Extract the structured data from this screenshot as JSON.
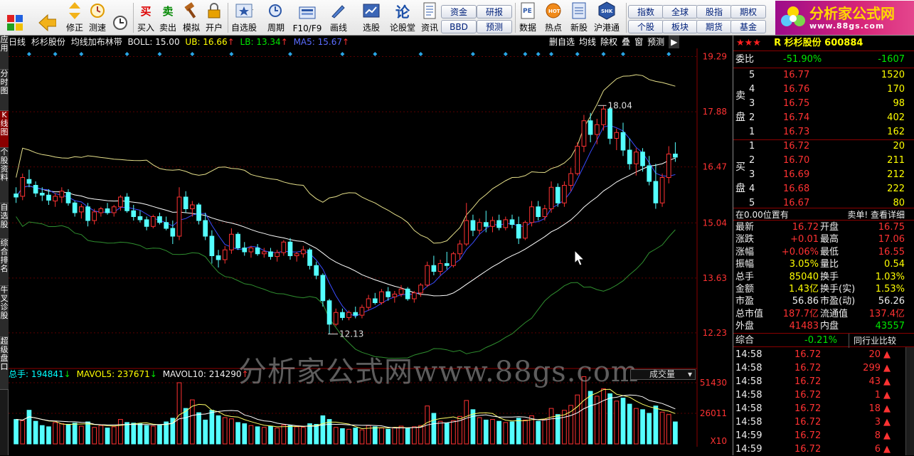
{
  "toolbar": {
    "buttons": [
      {
        "label": "",
        "icon": "grid-icon"
      },
      {
        "label": "",
        "icon": "back-arrow-icon"
      },
      {
        "label": "修正",
        "icon": "updown-icon"
      },
      {
        "label": "测速",
        "icon": "clock-icon"
      },
      {
        "label": "买入",
        "icon": "buy-icon"
      },
      {
        "label": "卖出",
        "icon": "sell-icon"
      },
      {
        "label": "模拟",
        "icon": "hammer-icon"
      },
      {
        "label": "开户",
        "icon": "lock-icon"
      },
      {
        "label": "自选股",
        "icon": "star-screen-icon"
      },
      {
        "label": "周期",
        "icon": "cycle-icon"
      },
      {
        "label": "F10/F9",
        "icon": "f10-icon"
      },
      {
        "label": "画线",
        "icon": "pen-icon"
      },
      {
        "label": "选股",
        "icon": "select-stock-icon"
      },
      {
        "label": "论股堂",
        "icon": "forum-icon"
      },
      {
        "label": "资讯",
        "icon": "news-icon"
      },
      {
        "label": "数据",
        "icon": "pe-icon"
      },
      {
        "label": "热点",
        "icon": "hot-icon"
      },
      {
        "label": "新股",
        "icon": "new-stock-icon"
      },
      {
        "label": "沪港通",
        "icon": "shhk-icon"
      }
    ],
    "pills": [
      "资金",
      "研报",
      "BBD",
      "预测",
      "指数",
      "全球",
      "股指",
      "期权",
      "个股",
      "板块",
      "期货",
      "基金"
    ],
    "logo": {
      "title": "分析家公式网",
      "url": "www.88gs.com"
    }
  },
  "lefttabs": [
    "应用",
    "分时图",
    "K线图",
    "个股资料",
    "自选股",
    "综合排名",
    "牛叉诊股",
    "超级盘口"
  ],
  "info": {
    "period": "日线",
    "stock": "杉杉股份",
    "indicator": "均线加布林带",
    "boll": "BOLL: 15.00",
    "ub": "UB: 16.66",
    "lb": "LB: 13.34",
    "ma": "MA5: 15.67",
    "tools": [
      "删自选",
      "均线",
      "除权",
      "叠",
      "窗",
      "预测"
    ]
  },
  "chart_data": {
    "type": "candlestick",
    "y_ticks": [
      19.29,
      17.88,
      16.47,
      15.04,
      13.63,
      12.23
    ],
    "ylim": [
      11.5,
      19.5
    ],
    "high_label": "18.04",
    "low_label": "12.13",
    "vol_ticks": [
      "51430",
      "26011",
      "X10"
    ],
    "volume_header": {
      "total": "总手: 194841",
      "mavol5": "MAVOL5: 237671",
      "mavol10": "MAVOL10: 214290"
    },
    "vol_selector": "成交量",
    "ohlc": [
      [
        15.78,
        15.95,
        15.55,
        15.7
      ],
      [
        15.72,
        16.3,
        15.62,
        16.2
      ],
      [
        16.15,
        16.4,
        15.95,
        16.05
      ],
      [
        16.0,
        16.1,
        15.7,
        15.8
      ],
      [
        15.8,
        15.95,
        15.6,
        15.75
      ],
      [
        15.75,
        15.9,
        15.5,
        15.62
      ],
      [
        15.6,
        15.8,
        15.45,
        15.72
      ],
      [
        15.7,
        15.95,
        15.55,
        15.85
      ],
      [
        15.82,
        15.9,
        15.48,
        15.55
      ],
      [
        15.55,
        15.6,
        15.2,
        15.3
      ],
      [
        15.32,
        15.52,
        15.15,
        15.45
      ],
      [
        15.45,
        15.55,
        14.95,
        15.1
      ],
      [
        15.1,
        15.4,
        15.0,
        15.32
      ],
      [
        15.3,
        15.45,
        15.2,
        15.4
      ],
      [
        15.4,
        15.55,
        15.25,
        15.3
      ],
      [
        15.3,
        15.5,
        15.2,
        15.45
      ],
      [
        15.45,
        15.75,
        15.35,
        15.7
      ],
      [
        15.7,
        15.8,
        15.3,
        15.35
      ],
      [
        15.35,
        15.5,
        15.1,
        15.2
      ],
      [
        15.2,
        15.35,
        15.05,
        15.12
      ],
      [
        15.12,
        15.2,
        14.85,
        14.95
      ],
      [
        14.95,
        15.25,
        14.9,
        15.2
      ],
      [
        15.2,
        15.3,
        15.0,
        15.05
      ],
      [
        15.05,
        15.2,
        14.85,
        14.9
      ],
      [
        14.9,
        15.1,
        14.5,
        14.7
      ],
      [
        14.7,
        15.95,
        14.6,
        15.7
      ],
      [
        15.7,
        15.85,
        15.3,
        15.4
      ],
      [
        15.4,
        15.6,
        15.2,
        15.5
      ],
      [
        15.5,
        15.55,
        15.0,
        15.1
      ],
      [
        15.1,
        15.3,
        14.6,
        14.7
      ],
      [
        14.7,
        14.85,
        14.0,
        14.2
      ],
      [
        14.2,
        14.35,
        13.9,
        14.1
      ],
      [
        14.1,
        14.45,
        14.0,
        14.35
      ],
      [
        14.35,
        14.9,
        14.25,
        14.75
      ],
      [
        14.75,
        14.8,
        14.35,
        14.4
      ],
      [
        14.4,
        14.55,
        14.2,
        14.3
      ],
      [
        14.3,
        14.45,
        14.15,
        14.4
      ],
      [
        14.4,
        14.5,
        14.2,
        14.25
      ],
      [
        14.25,
        14.4,
        14.15,
        14.3
      ],
      [
        14.3,
        14.4,
        14.1,
        14.18
      ],
      [
        14.18,
        14.35,
        14.05,
        14.28
      ],
      [
        14.28,
        14.6,
        14.2,
        14.55
      ],
      [
        14.55,
        14.65,
        14.1,
        14.2
      ],
      [
        14.2,
        14.3,
        14.05,
        14.25
      ],
      [
        14.25,
        14.45,
        14.15,
        14.35
      ],
      [
        14.35,
        14.4,
        13.85,
        13.95
      ],
      [
        13.95,
        14.05,
        13.6,
        13.7
      ],
      [
        13.7,
        13.75,
        12.9,
        13.05
      ],
      [
        13.05,
        13.1,
        12.2,
        12.45
      ],
      [
        12.45,
        12.85,
        12.4,
        12.75
      ],
      [
        12.75,
        12.85,
        12.55,
        12.62
      ],
      [
        12.62,
        12.8,
        12.55,
        12.75
      ],
      [
        12.75,
        12.9,
        12.6,
        12.68
      ],
      [
        12.68,
        12.95,
        12.6,
        12.88
      ],
      [
        12.88,
        13.2,
        12.8,
        13.1
      ],
      [
        13.1,
        13.25,
        12.95,
        13.0
      ],
      [
        13.0,
        13.35,
        12.95,
        13.28
      ],
      [
        13.28,
        13.4,
        13.05,
        13.15
      ],
      [
        13.15,
        13.3,
        13.0,
        13.22
      ],
      [
        13.22,
        13.45,
        13.15,
        13.35
      ],
      [
        13.35,
        13.4,
        13.05,
        13.1
      ],
      [
        13.1,
        13.3,
        13.0,
        13.25
      ],
      [
        13.25,
        13.5,
        13.15,
        13.45
      ],
      [
        13.45,
        14.05,
        13.4,
        13.95
      ],
      [
        13.95,
        14.2,
        13.7,
        13.8
      ],
      [
        13.8,
        14.1,
        13.7,
        14.0
      ],
      [
        14.0,
        14.3,
        13.85,
        13.95
      ],
      [
        13.95,
        14.3,
        13.9,
        14.25
      ],
      [
        14.25,
        14.6,
        14.1,
        14.5
      ],
      [
        14.5,
        15.55,
        14.45,
        15.1
      ],
      [
        15.1,
        15.25,
        14.7,
        14.85
      ],
      [
        14.85,
        15.15,
        14.75,
        15.05
      ],
      [
        15.05,
        15.35,
        14.8,
        14.95
      ],
      [
        14.95,
        15.2,
        14.8,
        15.1
      ],
      [
        15.1,
        15.25,
        14.85,
        14.92
      ],
      [
        14.92,
        15.2,
        14.85,
        15.12
      ],
      [
        15.12,
        15.25,
        14.9,
        15.0
      ],
      [
        15.0,
        15.2,
        14.5,
        14.65
      ],
      [
        14.65,
        15.1,
        14.6,
        15.05
      ],
      [
        15.05,
        15.6,
        14.95,
        15.45
      ],
      [
        15.45,
        15.6,
        15.1,
        15.2
      ],
      [
        15.2,
        15.5,
        15.1,
        15.4
      ],
      [
        15.4,
        16.1,
        15.3,
        15.95
      ],
      [
        15.95,
        16.05,
        15.45,
        15.55
      ],
      [
        15.55,
        16.1,
        15.45,
        16.0
      ],
      [
        16.0,
        16.45,
        15.85,
        16.3
      ],
      [
        16.3,
        17.1,
        16.25,
        17.0
      ],
      [
        17.0,
        17.8,
        16.85,
        17.65
      ],
      [
        17.65,
        17.85,
        17.1,
        17.3
      ],
      [
        17.3,
        17.7,
        17.05,
        17.55
      ],
      [
        17.55,
        18.04,
        17.4,
        17.95
      ],
      [
        17.95,
        18.0,
        17.05,
        17.2
      ],
      [
        17.2,
        17.45,
        16.9,
        17.35
      ],
      [
        17.35,
        17.6,
        16.75,
        16.9
      ],
      [
        16.9,
        17.2,
        16.4,
        16.55
      ],
      [
        16.55,
        16.95,
        16.25,
        16.85
      ],
      [
        16.85,
        16.95,
        16.35,
        16.5
      ],
      [
        16.5,
        16.75,
        16.0,
        16.1
      ],
      [
        16.1,
        16.55,
        15.4,
        15.55
      ],
      [
        15.55,
        16.3,
        15.45,
        16.2
      ],
      [
        16.2,
        17.0,
        16.05,
        16.8
      ],
      [
        16.8,
        17.1,
        16.6,
        16.72
      ]
    ],
    "volume": [
      0.4,
      0.38,
      0.55,
      0.37,
      0.3,
      0.28,
      0.35,
      0.33,
      0.32,
      0.34,
      0.29,
      0.36,
      0.27,
      0.3,
      0.26,
      0.28,
      0.4,
      0.35,
      0.34,
      0.33,
      0.3,
      0.29,
      0.31,
      0.36,
      0.42,
      1.0,
      0.58,
      0.72,
      0.51,
      0.39,
      0.55,
      0.46,
      0.43,
      0.41,
      0.35,
      0.33,
      0.3,
      0.28,
      0.27,
      0.29,
      0.26,
      0.31,
      0.3,
      0.28,
      0.27,
      0.33,
      0.32,
      0.46,
      0.4,
      0.27,
      0.25,
      0.24,
      0.26,
      0.23,
      0.3,
      0.28,
      0.26,
      0.24,
      0.27,
      0.29,
      0.26,
      0.28,
      0.3,
      0.62,
      0.5,
      0.37,
      0.34,
      0.38,
      0.45,
      0.71,
      0.56,
      0.43,
      0.39,
      0.4,
      0.37,
      0.35,
      0.36,
      0.42,
      0.39,
      0.46,
      0.37,
      0.4,
      0.58,
      0.48,
      0.55,
      0.63,
      0.8,
      1.1,
      0.86,
      0.78,
      0.9,
      0.82,
      0.7,
      0.75,
      0.65,
      0.58,
      0.56,
      0.5,
      0.62,
      0.52,
      0.48,
      0.36
    ]
  },
  "panel": {
    "title": "R 杉杉股份 600884",
    "weibi": {
      "label": "委比",
      "pct": "-51.90%",
      "val": "-1607"
    },
    "sell": [
      {
        "n": "5",
        "p": "16.77",
        "v": "1520"
      },
      {
        "n": "4",
        "p": "16.76",
        "v": "170"
      },
      {
        "n": "3",
        "p": "16.75",
        "v": "98"
      },
      {
        "n": "2",
        "p": "16.74",
        "v": "402"
      },
      {
        "n": "1",
        "p": "16.73",
        "v": "162"
      }
    ],
    "buy": [
      {
        "n": "1",
        "p": "16.72",
        "v": "20"
      },
      {
        "n": "2",
        "p": "16.70",
        "v": "211"
      },
      {
        "n": "3",
        "p": "16.69",
        "v": "212"
      },
      {
        "n": "4",
        "p": "16.68",
        "v": "222"
      },
      {
        "n": "5",
        "p": "16.67",
        "v": "80"
      }
    ],
    "sell_label": [
      "卖",
      "盘"
    ],
    "buy_label": [
      "买",
      "盘"
    ],
    "pos_left": "在0.00位置有",
    "pos_right": "卖单! 查看详细",
    "stats": [
      [
        "最新",
        "16.72",
        "开盘",
        "16.75"
      ],
      [
        "涨跌",
        "+0.01",
        "最高",
        "17.06"
      ],
      [
        "涨幅",
        "+0.06%",
        "最低",
        "16.55"
      ],
      [
        "振幅",
        "3.05%",
        "量比",
        "0.54"
      ],
      [
        "总手",
        "85040",
        "换手",
        "1.03%"
      ],
      [
        "金额",
        "1.43亿",
        "换手(实)",
        "1.53%"
      ],
      [
        "市盈",
        "56.86",
        "市盈(动)",
        "56.26"
      ],
      [
        "总市值",
        "187.7亿",
        "流通值",
        "137.4亿"
      ],
      [
        "外盘",
        "41483",
        "内盘",
        "43557"
      ]
    ],
    "composite": {
      "label": "综合",
      "pct": "-0.21%",
      "btn": "同行业比较"
    },
    "ticks": [
      [
        "14:58",
        "16.72",
        "20"
      ],
      [
        "14:58",
        "16.72",
        "299"
      ],
      [
        "14:58",
        "16.72",
        "43"
      ],
      [
        "14:58",
        "16.72",
        "1"
      ],
      [
        "14:58",
        "16.72",
        "18"
      ],
      [
        "14:58",
        "16.72",
        "3"
      ],
      [
        "14:59",
        "16.72",
        "8"
      ],
      [
        "14:59",
        "16.72",
        "6"
      ]
    ]
  },
  "watermark": "分析家公式网www.88gs.com"
}
